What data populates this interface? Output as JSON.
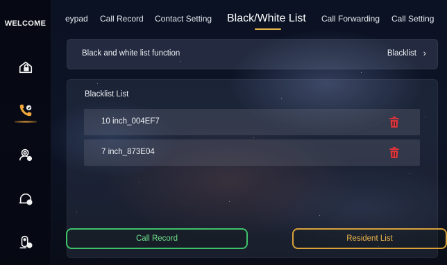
{
  "sidebar": {
    "welcome": "WELCOME",
    "items": [
      {
        "icon": "home-lock-icon"
      },
      {
        "icon": "phone-call-icon",
        "active": true
      },
      {
        "icon": "user-settings-icon"
      },
      {
        "icon": "cloud-doorbell-icon"
      },
      {
        "icon": "intercom-settings-icon"
      }
    ]
  },
  "tabs": [
    {
      "label": "eypad"
    },
    {
      "label": "Call Record"
    },
    {
      "label": "Contact Setting"
    },
    {
      "label": "Black/White List",
      "active": true
    },
    {
      "label": "Call Forwarding"
    },
    {
      "label": "Call Setting"
    }
  ],
  "function": {
    "label": "Black and white list function",
    "value": "Blacklist",
    "chevron": "›"
  },
  "list": {
    "title": "Blacklist List",
    "items": [
      {
        "name": "10 inch_004EF7"
      },
      {
        "name": "7 inch_873E04"
      }
    ]
  },
  "buttons": {
    "call_record": "Call Record",
    "resident_list": "Resident List"
  },
  "colors": {
    "accent_active": "#e8b84c",
    "delete": "#e0353b",
    "green_button": "#3fc36a",
    "orange_button": "#d9a23a"
  }
}
